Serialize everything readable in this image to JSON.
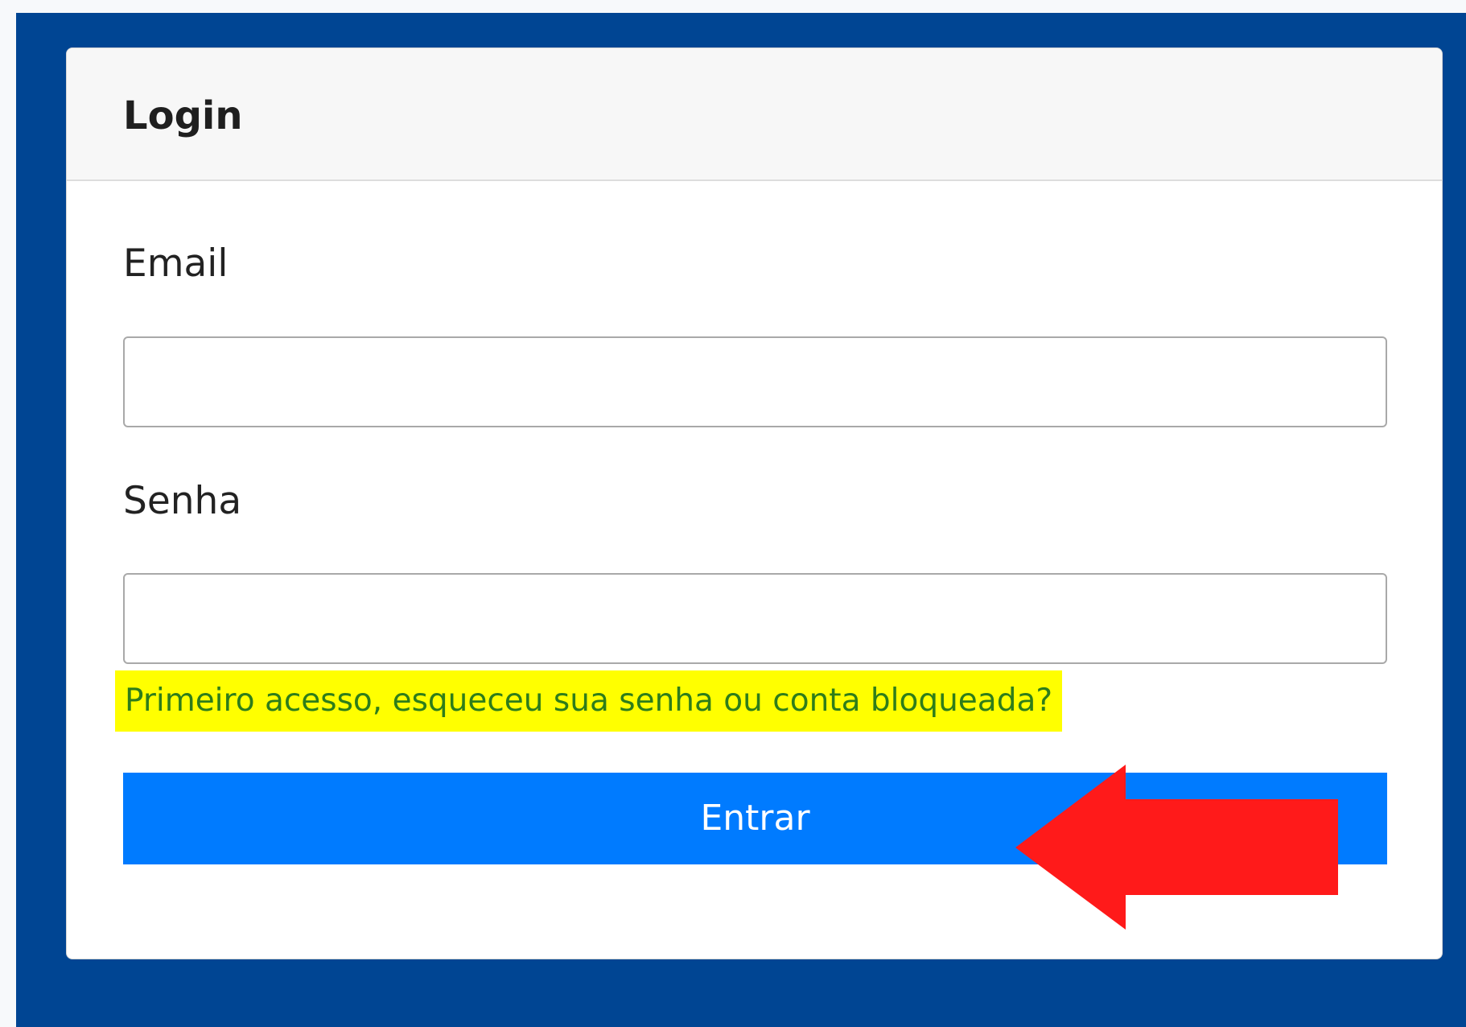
{
  "login_form": {
    "title": "Login",
    "email_label": "Email",
    "email_value": "",
    "password_label": "Senha",
    "password_value": "",
    "help_link_text": "Primeiro acesso, esqueceu sua senha ou conta bloqueada?",
    "submit_label": "Entrar"
  },
  "annotations": {
    "highlight_color": "#ffff00",
    "arrow_color": "#ff1a1a",
    "arrow_direction": "left",
    "arrow_icon": "red-arrow-icon"
  },
  "colors": {
    "background_panel": "#004593",
    "card_header": "#f7f7f7",
    "button_primary": "#007bff",
    "link_text": "#2e7d1a"
  }
}
